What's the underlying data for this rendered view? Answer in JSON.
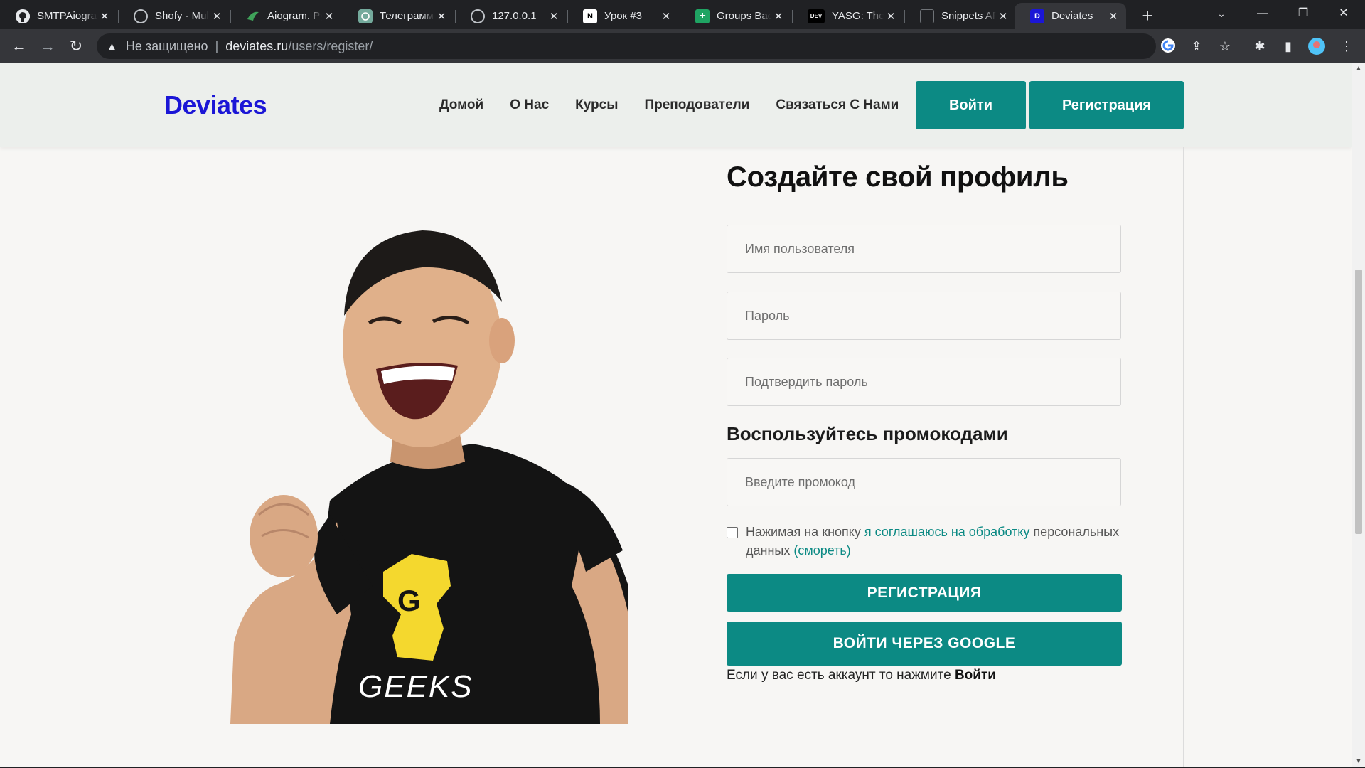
{
  "browser": {
    "tabs": [
      {
        "label": "SMTPAiogram",
        "icon": "github-icon"
      },
      {
        "label": "Shofy - Multipurpose",
        "icon": "globe-icon"
      },
      {
        "label": "Aiogram. Python",
        "icon": "aiogram-icon"
      },
      {
        "label": "Телеграмм",
        "icon": "chatgpt-icon"
      },
      {
        "label": "127.0.0.1",
        "icon": "globe-icon"
      },
      {
        "label": "Урок #3",
        "icon": "notion-icon"
      },
      {
        "label": "Groups Back",
        "icon": "sheets-icon"
      },
      {
        "label": "YASG: The Py",
        "icon": "dev-icon"
      },
      {
        "label": "Snippets API",
        "icon": "drf-icon"
      },
      {
        "label": "Deviates",
        "icon": "deviates-icon",
        "active": true
      }
    ],
    "address": {
      "security_label": "Не защищено",
      "host": "deviates.ru",
      "path": "/users/register/"
    }
  },
  "header": {
    "logo": "Deviates",
    "nav": [
      "Домой",
      "О Нас",
      "Курсы",
      "Преподователи",
      "Связаться С Нами"
    ],
    "login_button": "Войти",
    "register_button": "Регистрация"
  },
  "form": {
    "title": "Создайте свой профиль",
    "username_placeholder": "Имя пользователя",
    "password_placeholder": "Пароль",
    "confirm_placeholder": "Подтвердить пароль",
    "promo_title": "Воспользуйтесь промокодами",
    "promo_placeholder": "Введите промокод",
    "agree_prefix": "Нажимая на кнопку",
    "agree_link": "я соглашаюсь на обработку",
    "agree_suffix": "персональных данных",
    "agree_view": "(смореть)",
    "submit_button": "РЕГИСТРАЦИЯ",
    "google_button": "ВОЙТИ ЧЕРЕЗ GOOGLE",
    "login_hint": "Если у вас есть аккаунт то нажмите",
    "login_hint_link": "Войти"
  },
  "photo": {
    "shirt_text": "GEEKS",
    "shirt_letter": "G"
  },
  "colors": {
    "accent": "#0c8a84",
    "logo": "#1b16d6",
    "page_bg": "#f7f6f4",
    "header_bg": "#ecefec"
  }
}
